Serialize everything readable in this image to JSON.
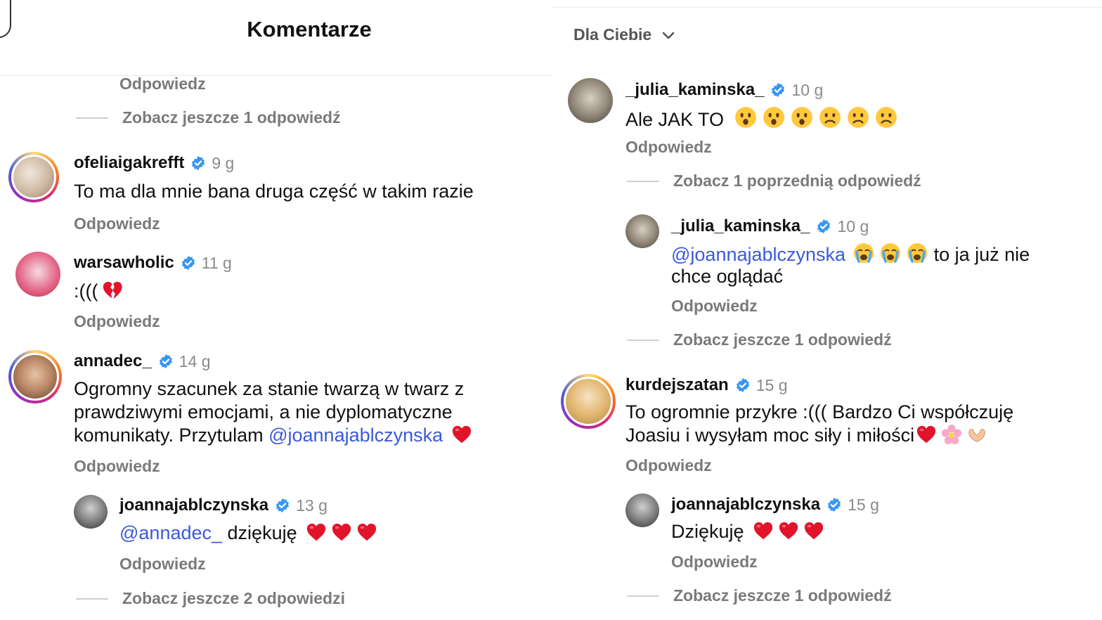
{
  "left": {
    "title": "Komentarze",
    "top_reply": "Odpowiedz",
    "top_more": "Zobacz jeszcze 1 odpowiedź",
    "comments": [
      {
        "username": "ofeliaigakrefft",
        "time": "9 g",
        "text": "To ma dla mnie bana druga część w takim razie",
        "reply": "Odpowiedz"
      },
      {
        "username": "warsawholic",
        "time": "11 g",
        "text": ":(((",
        "reply": "Odpowiedz"
      },
      {
        "username": "annadec_",
        "time": "14 g",
        "text_lines": [
          "Ogromny szacunek za stanie twarzą w twarz z",
          "prawdziwymi emocjami, a nie dyplomatyczne",
          "komunikaty. Przytulam "
        ],
        "mention": "@joannajablczynska",
        "reply": "Odpowiedz"
      },
      {
        "username": "joannajablczynska",
        "time": "13 g",
        "mention": "@annadec_",
        "text": " dziękuję",
        "reply": "Odpowiedz"
      }
    ],
    "bottom_more": "Zobacz jeszcze 2 odpowiedzi"
  },
  "right": {
    "sort_label": "Dla Ciebie",
    "comments": [
      {
        "username": "_julia_kaminska_",
        "time": "10 g",
        "text": "Ale JAK TO",
        "reply": "Odpowiedz"
      },
      {
        "username": "_julia_kaminska_",
        "time": "10 g",
        "mention": "@joannajablczynska",
        "text_tail": "to ja już nie",
        "text_line2": "chce oglądać",
        "reply": "Odpowiedz"
      },
      {
        "username": "kurdejszatan",
        "time": "15 g",
        "text_lines": [
          "To ogromnie przykre :((( Bardzo Ci współczuję",
          "Joasiu i wysyłam moc siły i miłości"
        ],
        "reply": "Odpowiedz"
      },
      {
        "username": "joannajablczynska",
        "time": "15 g",
        "text": "Dziękuję",
        "reply": "Odpowiedz"
      }
    ],
    "prev_more": "Zobacz 1 poprzednią odpowiedź",
    "more1": "Zobacz jeszcze 1 odpowiedź",
    "more2": "Zobacz jeszcze 1 odpowiedź"
  },
  "colors": {
    "mention": "#3a5ad9",
    "verified": "#3897f0",
    "muted": "#7a7a7a",
    "heart": "#e0142a"
  },
  "icons": [
    "verified-badge-icon",
    "chevron-down-icon",
    "heart-icon",
    "broken-heart-icon",
    "surprised-face-icon",
    "frowning-face-icon",
    "crying-face-icon",
    "blossom-icon",
    "heart-hands-icon"
  ]
}
